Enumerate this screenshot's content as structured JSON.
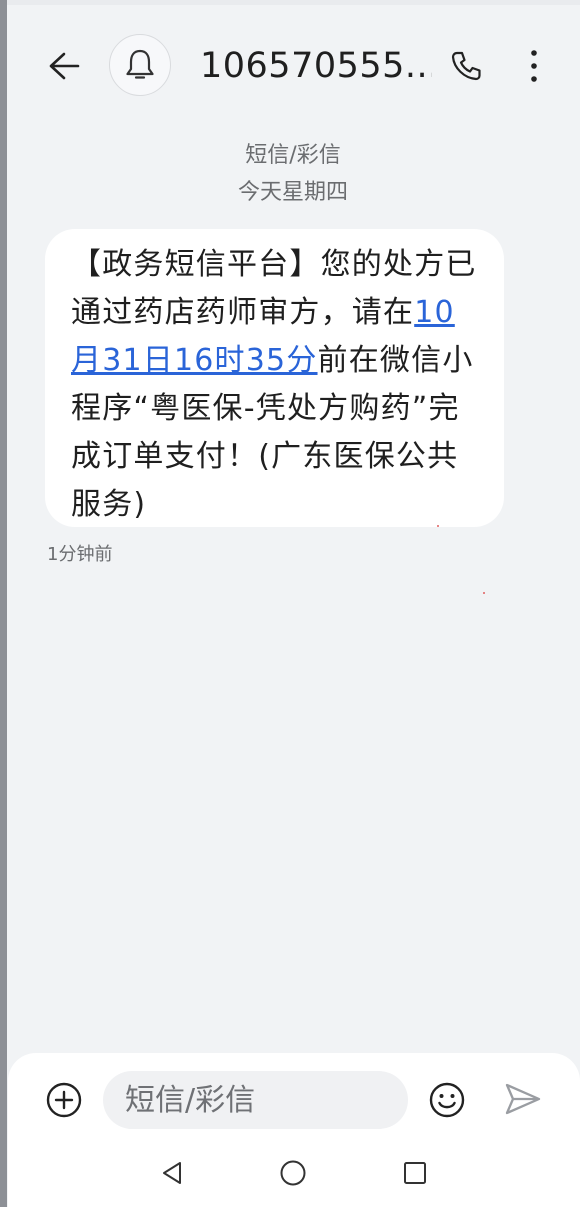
{
  "header": {
    "title": "106570555...",
    "icons": {
      "back": "back-arrow-icon",
      "avatar": "bell-icon",
      "call": "phone-icon",
      "more": "more-vertical-icon"
    }
  },
  "thread": {
    "type_label": "短信/彩信",
    "date_label": "今天星期四"
  },
  "message": {
    "text_before": "【政务短信平台】您的处方已通过药店药师审方，请在",
    "link_text": "10月31日16时35分",
    "text_after": "前在微信小程序“粤医保-凭处方购药”完成订单支付！(广东医保公共服务)",
    "time": "1分钟前"
  },
  "composer": {
    "placeholder": "短信/彩信",
    "value": "",
    "icons": {
      "add": "add-circle-icon",
      "emoji": "emoji-icon",
      "send": "send-icon"
    }
  },
  "navbar": {
    "icons": [
      "nav-back-icon",
      "nav-home-icon",
      "nav-recent-icon"
    ]
  },
  "colors": {
    "background": "#f1f3f5",
    "bubble": "#ffffff",
    "link": "#2a64d8",
    "text": "#1f1f1f",
    "muted": "#6b6d70"
  }
}
